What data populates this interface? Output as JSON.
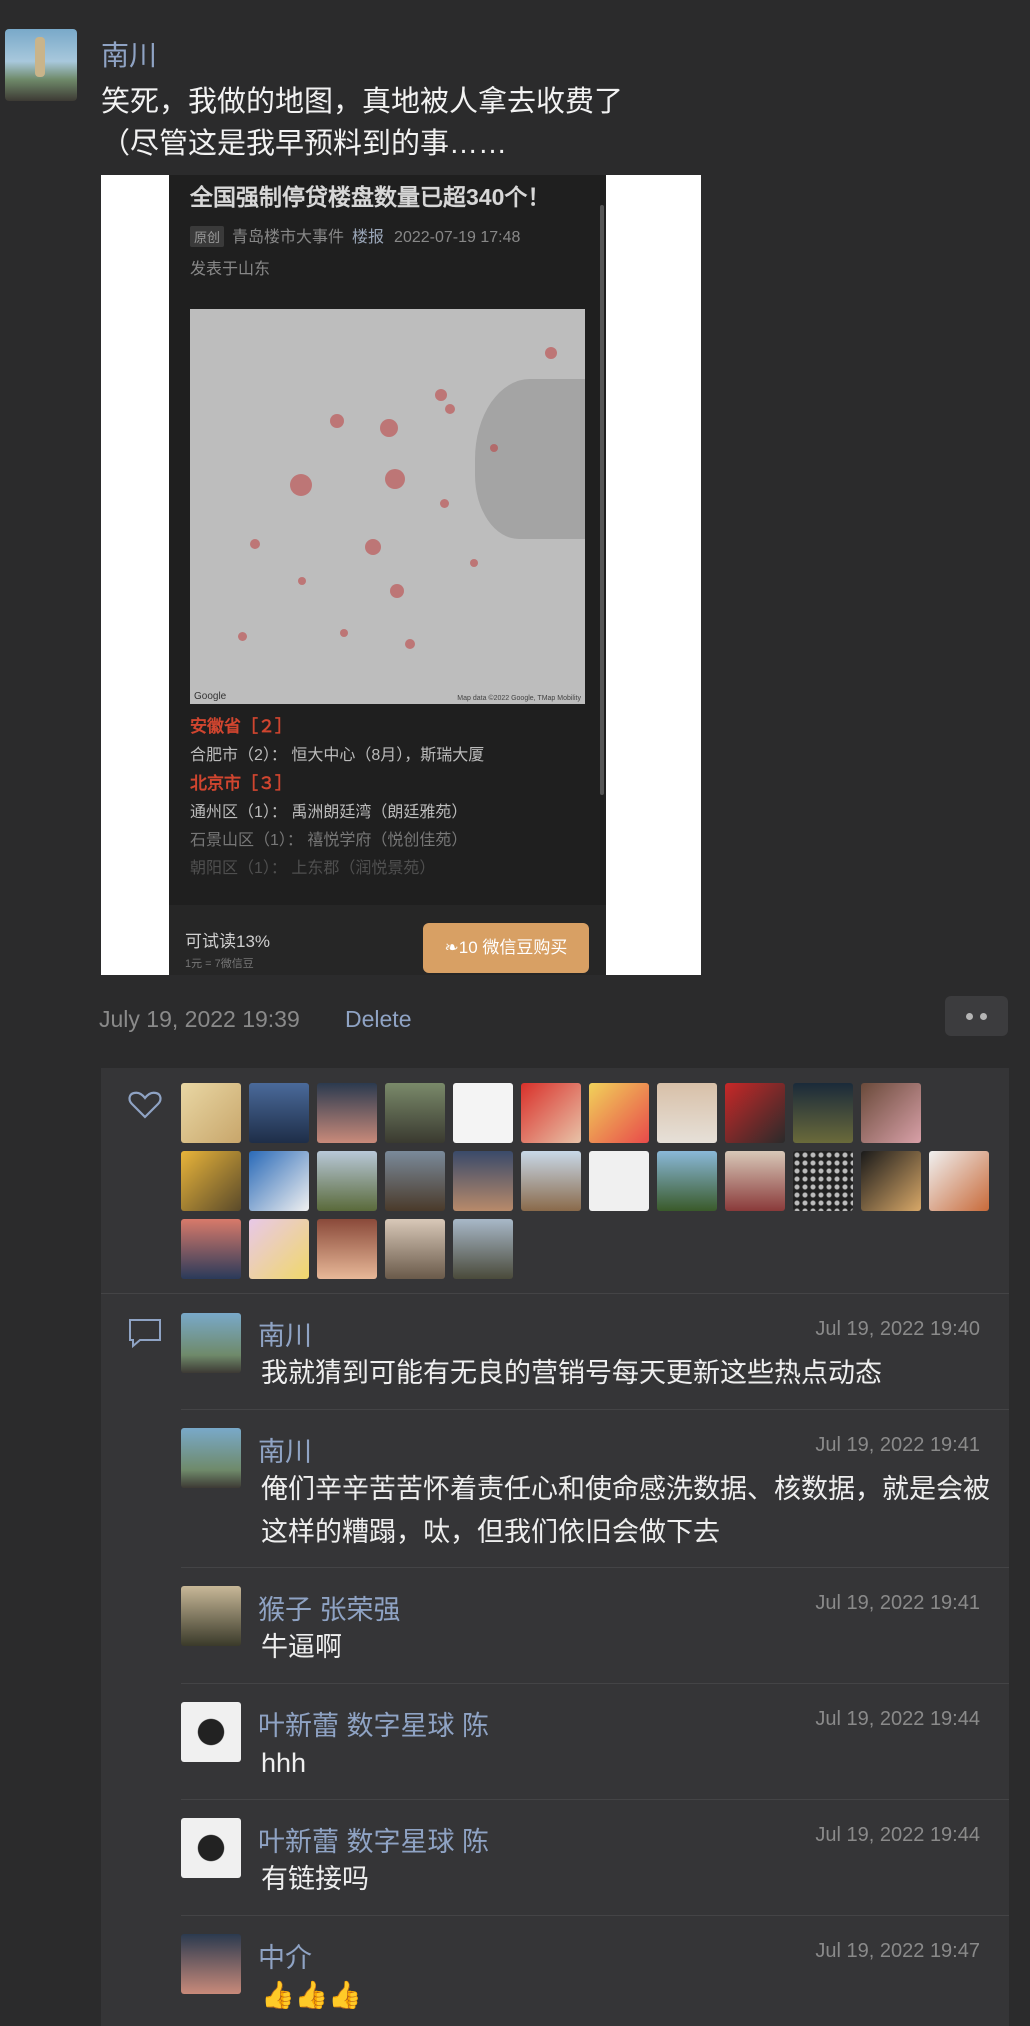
{
  "post": {
    "author": "南川",
    "text": "笑死，我做的地图，真地被人拿去收费了\n（尽管这是我早预料到的事……",
    "timestamp": "July 19, 2022 19:39",
    "delete_label": "Delete"
  },
  "article": {
    "title": "全国强制停贷楼盘数量已超340个！",
    "tag": "原创",
    "source": "青岛楼市大事件",
    "source_link": "楼报",
    "date": "2022-07-19 17:48",
    "location": "发表于山东",
    "map_logo": "Google",
    "map_credit": "Map data ©2022 Google, TMap Mobility",
    "lines": [
      {
        "kind": "prov",
        "text": "安徽省［２］"
      },
      {
        "kind": "line",
        "text": "合肥市（2）：  恒大中心（8月），斯瑞大厦"
      },
      {
        "kind": "prov",
        "text": "北京市［３］"
      },
      {
        "kind": "line",
        "text": "通州区（1）：  禹洲朗廷湾（朗廷雅苑）"
      },
      {
        "kind": "dim",
        "text": "石景山区（1）：  禧悦学府（悦创佳苑）"
      },
      {
        "kind": "dimmer",
        "text": "朝阳区（1）：  上东郡（润悦景苑）"
      }
    ],
    "try_read": "可试读13%",
    "price_note": "1元 = 7微信豆",
    "buy_label": "10 微信豆购买"
  },
  "comments": [
    {
      "name": "南川",
      "time": "Jul 19, 2022 19:40",
      "text": "我就猜到可能有无良的营销号每天更新这些热点动态"
    },
    {
      "name": "南川",
      "time": "Jul 19, 2022 19:41",
      "text": "俺们辛辛苦苦怀着责任心和使命感洗数据、核数据，就是会被这样的糟蹋，呔，但我们依旧会做下去"
    },
    {
      "name": "猴子 张荣强",
      "time": "Jul 19, 2022 19:41",
      "text": "牛逼啊"
    },
    {
      "name": "叶新蕾 数字星球 陈",
      "time": "Jul 19, 2022 19:44",
      "text": "hhh"
    },
    {
      "name": "叶新蕾 数字星球 陈",
      "time": "Jul 19, 2022 19:44",
      "text": "有链接吗"
    },
    {
      "name": "中介",
      "time": "Jul 19, 2022 19:47",
      "text": "👍👍👍"
    }
  ],
  "colors": {
    "name_link": "#8fa3c4",
    "buy_button": "#d8a064",
    "province": "#d0452f"
  }
}
